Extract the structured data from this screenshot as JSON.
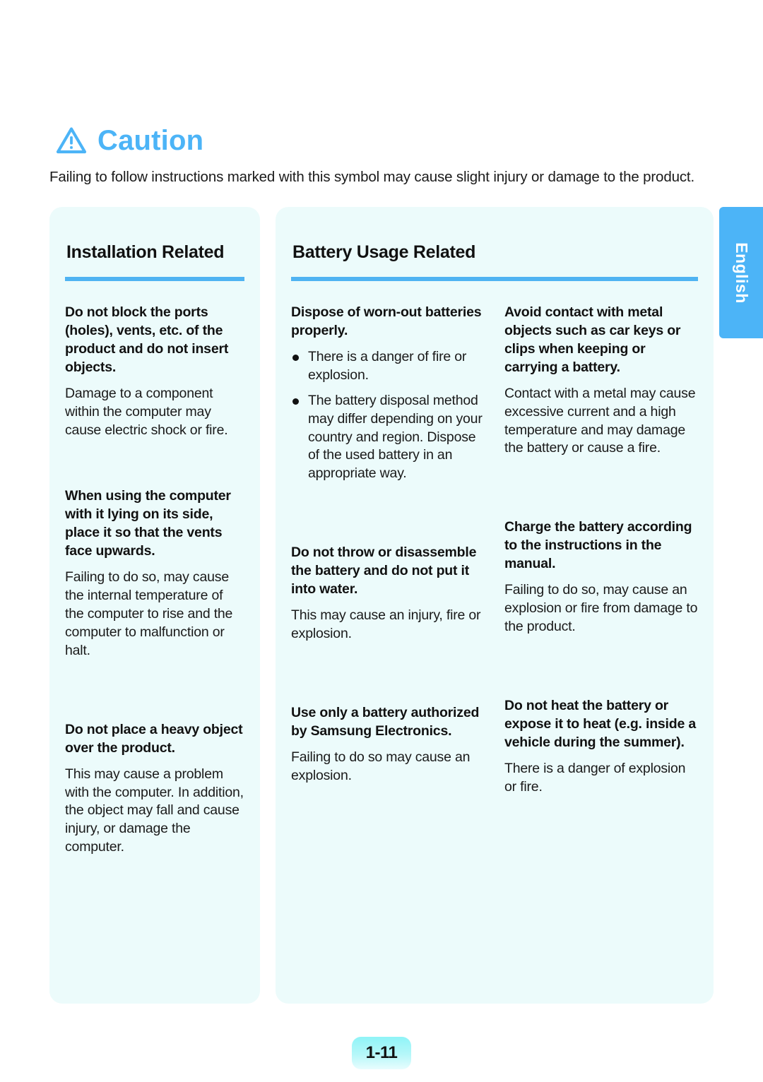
{
  "caution": {
    "icon": "warning-triangle-icon",
    "title": "Caution",
    "title_color": "#4cb4f7",
    "description": "Failing to follow instructions marked with this symbol may cause slight injury or damage to the product."
  },
  "side_tab": {
    "label": "English",
    "background_color": "#4cb4f7",
    "text_color": "#ffffff"
  },
  "footer": {
    "page_number": "1-11"
  },
  "panels": [
    {
      "title": "Installation Related",
      "rule_color": "#4fb3f2",
      "columns": [
        {
          "entries": [
            {
              "heading": "Do not block the ports (holes), vents, etc. of the product and do not insert objects.",
              "body": "Damage to a component within the computer may cause electric shock or fire."
            },
            {
              "heading": "When using the computer with it lying on its side, place it so that the vents face upwards.",
              "body": "Failing to do so, may cause the internal temperature of the computer to rise and the computer to malfunction or halt."
            },
            {
              "heading": "Do not place a heavy object over the product.",
              "body": "This may cause a problem with the computer. In addition, the object may fall and cause injury, or damage the computer."
            }
          ]
        }
      ]
    },
    {
      "title": "Battery Usage Related",
      "rule_color": "#4fb3f2",
      "columns": [
        {
          "entries": [
            {
              "heading": "Dispose of worn-out batteries properly.",
              "bullets": [
                "There is a danger of fire or explosion.",
                "The battery disposal method may differ depending on your country and region. Dispose of the used battery in an appropriate way."
              ]
            },
            {
              "heading": "Do not throw or disassemble the battery and do not put it into water.",
              "body": "This may cause an injury, fire or explosion."
            },
            {
              "heading": "Use only a battery authorized by Samsung Electronics.",
              "body": "Failing to do so may cause an explosion."
            }
          ]
        },
        {
          "entries": [
            {
              "heading": "Avoid contact with metal objects such as car keys or clips when keeping or carrying a battery.",
              "body": "Contact with a metal may cause excessive current and a high temperature and may damage the battery or cause a fire."
            },
            {
              "heading": "Charge the battery according to the instructions in the manual.",
              "body": "Failing to do so, may cause an explosion or fire from damage to the product."
            },
            {
              "heading": "Do not heat the battery or expose it to heat (e.g. inside a vehicle during the summer).",
              "body": "There is a danger of explosion or fire."
            }
          ]
        }
      ]
    }
  ]
}
